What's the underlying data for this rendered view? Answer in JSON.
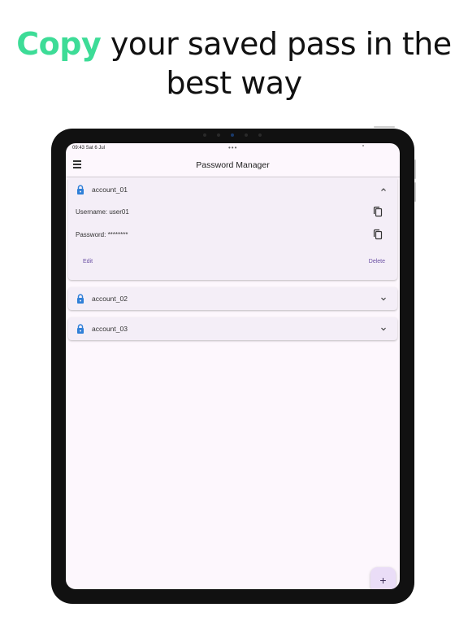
{
  "headline": {
    "accent": "Copy",
    "rest_line1": " your saved pass in the",
    "line2": "best way"
  },
  "status_bar": {
    "time": "09:43  Sat 6 Jul",
    "dots": "•••"
  },
  "app": {
    "title": "Password Manager",
    "menu_icon": "hamburger-menu-icon"
  },
  "accounts": [
    {
      "name": "account_01",
      "expanded": true,
      "username_label": "Username: user01",
      "password_label": "Password: ********",
      "edit_label": "Edit",
      "delete_label": "Delete"
    },
    {
      "name": "account_02",
      "expanded": false
    },
    {
      "name": "account_03",
      "expanded": false
    }
  ],
  "fab": {
    "label": "+"
  },
  "colors": {
    "accent_green": "#3ddc97",
    "lock_blue": "#2f80d8",
    "button_purple": "#6a4fa3",
    "screen_bg": "#fdf7fd",
    "card_bg": "#f4eef7",
    "fab_bg": "#eaddf7"
  }
}
